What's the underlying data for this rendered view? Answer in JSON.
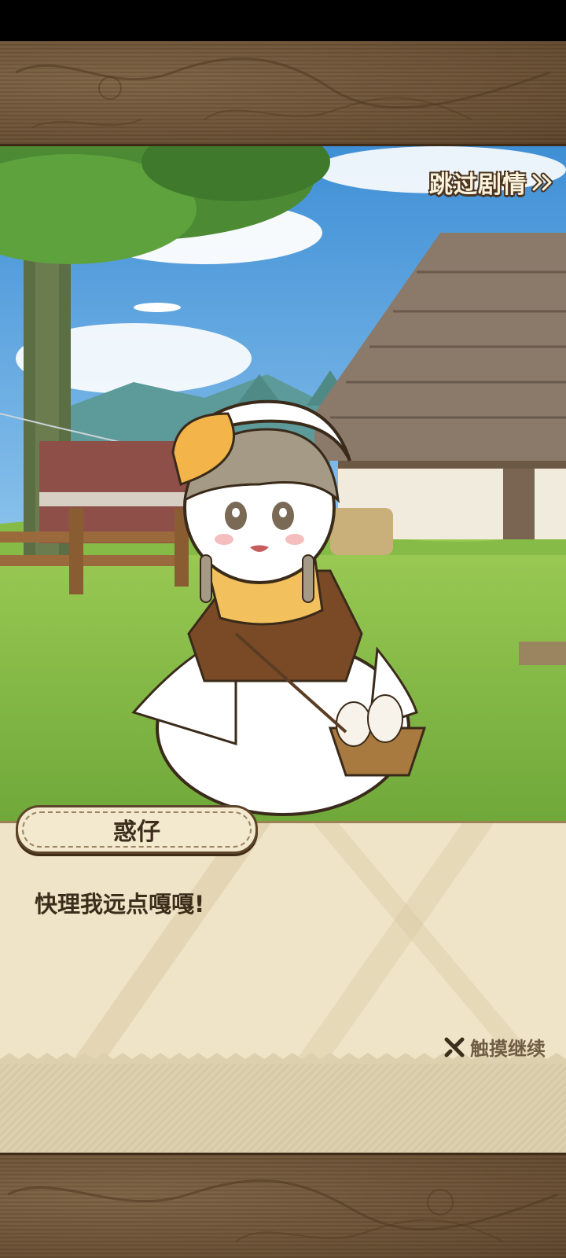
{
  "skip": {
    "label": "跳过剧情",
    "icon": "double-chevron-right-icon"
  },
  "dialog": {
    "speaker": "惑仔",
    "text": "快理我远点嘎嘎!",
    "continue_label": "触摸继续",
    "continue_icon": "sword-cross-icon"
  },
  "colors": {
    "frame": "#6e5538",
    "parchment": "#efe4c8",
    "text": "#3d2e1c",
    "sky": "#5fa6df",
    "grass": "#8fc34a"
  }
}
